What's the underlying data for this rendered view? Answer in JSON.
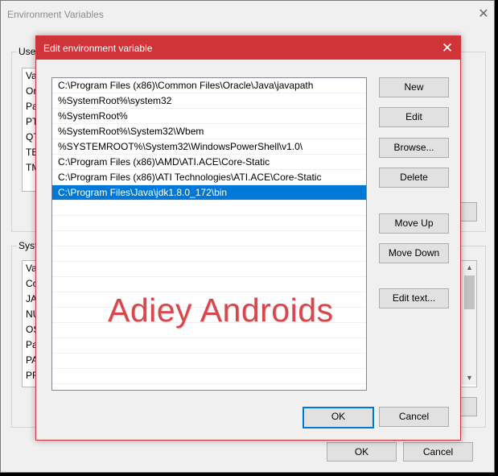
{
  "background_window": {
    "title": "Environment Variables",
    "user_group_label": "User",
    "user_list": [
      "Va",
      "Or",
      "Pa",
      "PT",
      "QT",
      "TE",
      "TM"
    ],
    "system_group_label": "Syste",
    "system_list": [
      "Va",
      "Co",
      "JA",
      "NU",
      "OS",
      "Pa",
      "PA",
      "PR"
    ],
    "ok_label": "OK",
    "cancel_label": "Cancel"
  },
  "dialog": {
    "title": "Edit environment variable",
    "paths": [
      "C:\\Program Files (x86)\\Common Files\\Oracle\\Java\\javapath",
      "%SystemRoot%\\system32",
      "%SystemRoot%",
      "%SystemRoot%\\System32\\Wbem",
      "%SYSTEMROOT%\\System32\\WindowsPowerShell\\v1.0\\",
      "C:\\Program Files (x86)\\AMD\\ATI.ACE\\Core-Static",
      "C:\\Program Files (x86)\\ATI Technologies\\ATI.ACE\\Core-Static",
      "C:\\Program Files\\Java\\jdk1.8.0_172\\bin"
    ],
    "selected_index": 7,
    "buttons": {
      "new": "New",
      "edit": "Edit",
      "browse": "Browse...",
      "delete": "Delete",
      "move_up": "Move Up",
      "move_down": "Move Down",
      "edit_text": "Edit text...",
      "ok": "OK",
      "cancel": "Cancel"
    },
    "watermark": "Adiey Androids"
  },
  "colors": {
    "accent": "#d13438",
    "selection": "#0078d7",
    "watermark": "#d7474b"
  },
  "icons": {
    "close": "close-icon",
    "scroll_up": "chevron-up-icon",
    "scroll_down": "chevron-down-icon"
  }
}
